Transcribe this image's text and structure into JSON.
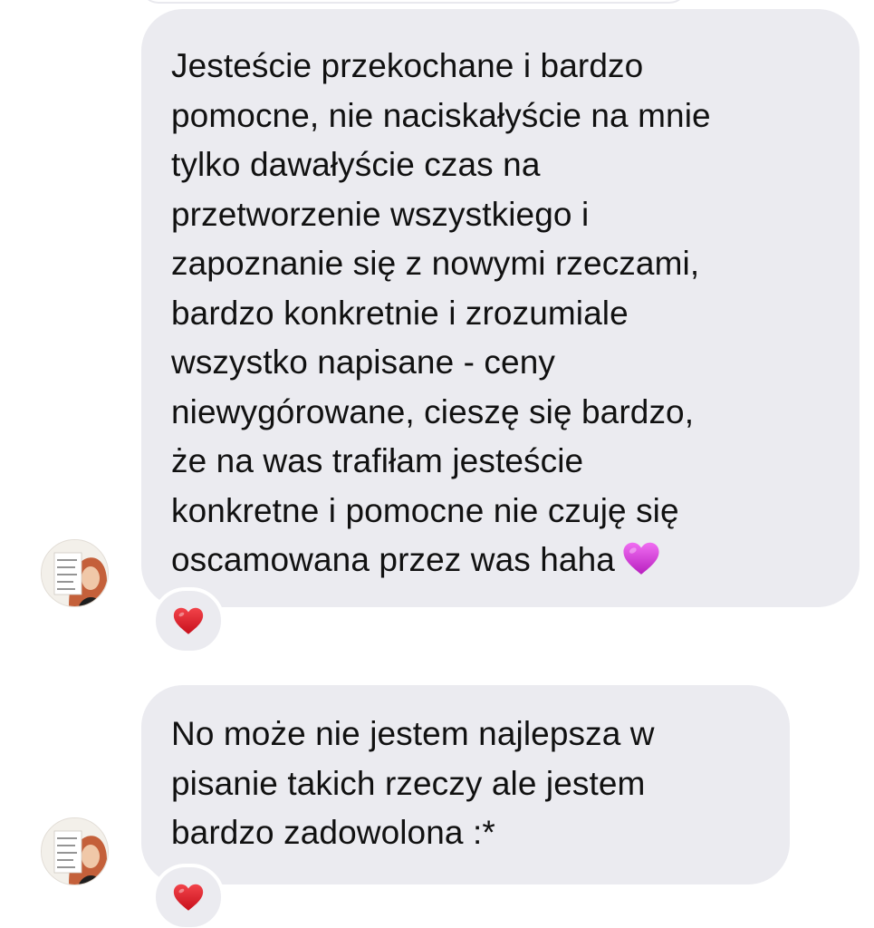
{
  "messages": [
    {
      "lines": [
        "Jesteście przekochane i bardzo",
        "pomocne, nie naciskałyście na mnie",
        "tylko dawałyście czas na",
        "przetworzenie wszystkiego i",
        "zapoznanie się z nowymi rzeczami,",
        "bardzo konkretnie i zrozumiale",
        "wszystko napisane - ceny",
        "niewygórowane, cieszę się bardzo,",
        "że na was trafiłam jesteście",
        "konkretne i pomocne nie czuję się",
        "oscamowana przez was haha"
      ],
      "emoji": "purple-heart-icon",
      "reaction": "red-heart-icon"
    },
    {
      "lines": [
        "No może nie jestem najlepsza w",
        "pisanie takich rzeczy ale jestem",
        "bardzo zadowolona :*"
      ],
      "reaction": "red-heart-icon"
    }
  ],
  "colors": {
    "bubble": "#ebebf0",
    "text": "#111111",
    "heart_red": "#e0202b",
    "heart_pink": "#cc2fd0"
  }
}
